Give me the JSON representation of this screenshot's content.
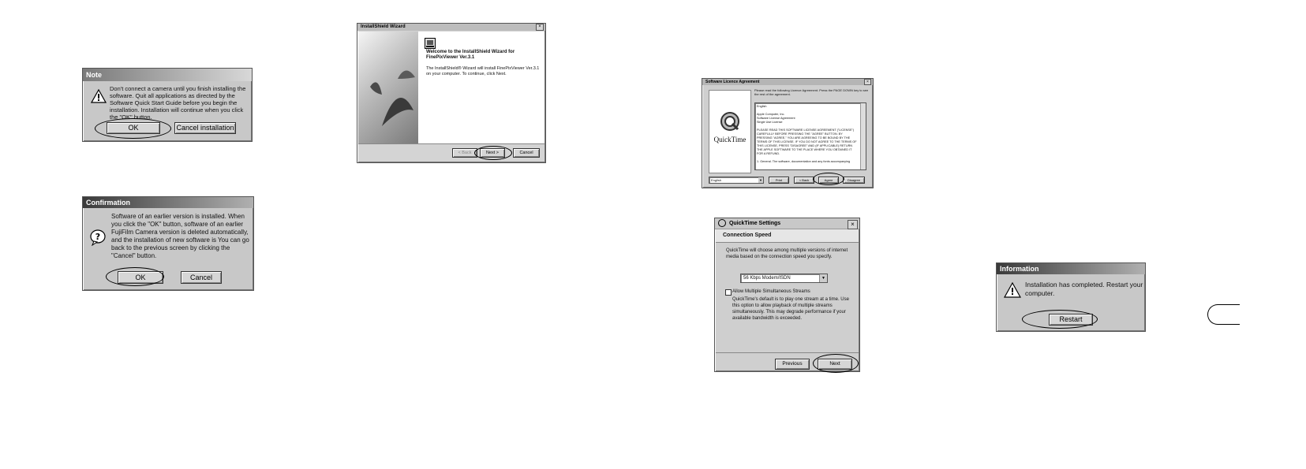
{
  "note": {
    "title": "Note",
    "message": "Don't connect a camera until you finish installing the software. Quit all applications as directed by the Software Quick Start Guide before you begin the installation. Installation will continue when you click the \"OK\" button.",
    "ok_label": "OK",
    "cancel_label": "Cancel installation"
  },
  "confirm": {
    "title": "Confirmation",
    "message": "Software of an earlier version is installed. When you click the \"OK\" button, software of an earlier FujiFilm Camera version is deleted automatically, and the installation of new software is You can go back to the previous screen by clicking the \"Cancel\" button.",
    "ok_label": "OK",
    "cancel_label": "Cancel"
  },
  "wizard": {
    "title": "InstallShield Wizard",
    "heading": "Welcome to the InstallShield Wizard for FinePixViewer Ver.3.1",
    "body": "The InstallShield® Wizard will install FinePixViewer Ver.3.1 on your computer.  To continue, click Next.",
    "back_label": "< Back",
    "next_label": "Next >",
    "cancel_label": "Cancel"
  },
  "license": {
    "title": "Software Licence Agreement",
    "instruction": "Please read the following Licence Agreement. Press the PAGE DOWN key to see the rest of the agreement.",
    "logo_text": "QuickTime",
    "agreement_text": "English\n\nApple Computer, Inc.\nSoftware License Agreement\nSingle Use License\n\nPLEASE READ THIS SOFTWARE LICENSE AGREEMENT (\"LICENSE\") CAREFULLY BEFORE PRESSING THE \"AGREE\" BUTTON. BY PRESSING \"AGREE,\" YOU ARE AGREEING TO BE BOUND BY THE TERMS OF THIS LICENSE. IF YOU DO NOT AGREE TO THE TERMS OF THIS LICENSE, PRESS \"DISAGREE\" AND (IF APPLICABLE) RETURN THE APPLE SOFTWARE TO THE PLACE WHERE YOU OBTAINED IT FOR A REFUND.\n\n1. General. The software, documentation and any fonts accompanying",
    "language_value": "English",
    "print_label": "Print",
    "back_label": "< Back",
    "agree_label": "Agree",
    "disagree_label": "Disagree"
  },
  "qt_settings": {
    "title": "QuickTime Settings",
    "section": "Connection Speed",
    "intro": "QuickTime will choose among multiple versions of internet media based on the connection speed you specify.",
    "speed_value": "56 Kbps Modem/ISDN",
    "checkbox_label": "Allow Multiple Simultaneous Streams",
    "explanation": "QuickTime's default is to play one stream at a time. Use this option to allow playback of multiple streams simultaneously. This may degrade performance if your available bandwidth is exceeded.",
    "previous_label": "Previous",
    "next_label": "Next"
  },
  "info": {
    "title": "Information",
    "message": "Installation has completed. Restart your computer.",
    "restart_label": "Restart"
  }
}
